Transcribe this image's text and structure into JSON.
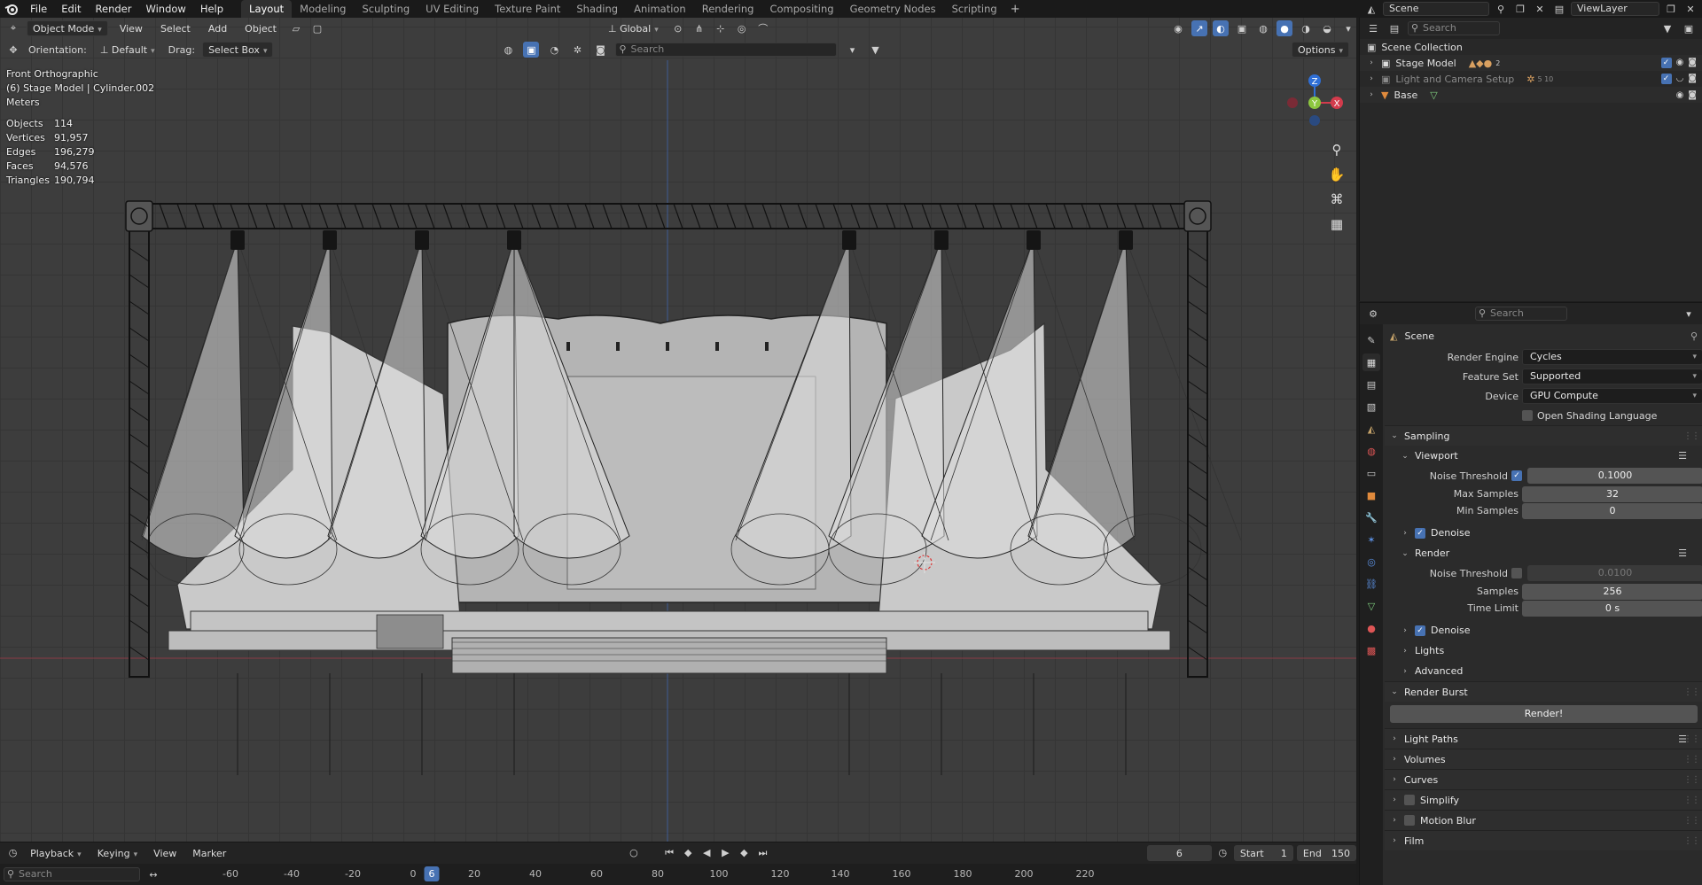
{
  "menu": {
    "items": [
      "File",
      "Edit",
      "Render",
      "Window",
      "Help"
    ]
  },
  "workspaces": [
    "Layout",
    "Modeling",
    "Sculpting",
    "UV Editing",
    "Texture Paint",
    "Shading",
    "Animation",
    "Rendering",
    "Compositing",
    "Geometry Nodes",
    "Scripting"
  ],
  "active_workspace": "Layout",
  "top_right": {
    "scene": "Scene",
    "view_layer": "ViewLayer"
  },
  "viewport": {
    "mode": "Object Mode",
    "menus": [
      "View",
      "Select",
      "Add",
      "Object"
    ],
    "transform_orientation": "Global",
    "orientation_label": "Orientation:",
    "orientation_value": "Default",
    "drag_label": "Drag:",
    "drag_value": "Select Box",
    "search_placeholder": "Search",
    "options": "Options",
    "overlay_lines": [
      "Front Orthographic",
      "(6) Stage Model | Cylinder.002",
      "Meters"
    ],
    "stats": [
      {
        "label": "Objects",
        "value": "114"
      },
      {
        "label": "Vertices",
        "value": "91,957"
      },
      {
        "label": "Edges",
        "value": "196,279"
      },
      {
        "label": "Faces",
        "value": "94,576"
      },
      {
        "label": "Triangles",
        "value": "190,794"
      }
    ],
    "gizmo": {
      "z": "Z",
      "y": "Y",
      "x": "X"
    }
  },
  "timeline": {
    "menus": [
      "Playback",
      "Keying",
      "View",
      "Marker"
    ],
    "current_frame": "6",
    "start_label": "Start",
    "start": "1",
    "end_label": "End",
    "end": "150",
    "search_placeholder": "Search",
    "ruler": [
      "-60",
      "-40",
      "-20",
      "0",
      "20",
      "40",
      "60",
      "80",
      "100",
      "120",
      "140",
      "160",
      "180",
      "200",
      "220"
    ],
    "ruler_current": "6"
  },
  "outliner": {
    "search_placeholder": "Search",
    "root": "Scene Collection",
    "items": [
      {
        "label": "Stage Model",
        "counts": "2"
      },
      {
        "label": "Light and Camera Setup",
        "counts": "5 10"
      },
      {
        "label": "Base",
        "counts": ""
      }
    ]
  },
  "properties": {
    "search_placeholder": "Search",
    "context": "Scene",
    "render_engine_label": "Render Engine",
    "render_engine": "Cycles",
    "feature_set_label": "Feature Set",
    "feature_set": "Supported",
    "device_label": "Device",
    "device": "GPU Compute",
    "osl_label": "Open Shading Language",
    "sampling": "Sampling",
    "viewport": "Viewport",
    "vp_noise_label": "Noise Threshold",
    "vp_noise": "0.1000",
    "vp_max_label": "Max Samples",
    "vp_max": "32",
    "vp_min_label": "Min Samples",
    "vp_min": "0",
    "denoise": "Denoise",
    "render": "Render",
    "r_noise_label": "Noise Threshold",
    "r_noise": "0.0100",
    "r_samples_label": "Samples",
    "r_samples": "256",
    "r_time_label": "Time Limit",
    "r_time": "0 s",
    "lights": "Lights",
    "advanced": "Advanced",
    "render_burst": "Render Burst",
    "render_button": "Render!",
    "light_paths": "Light Paths",
    "volumes": "Volumes",
    "curves": "Curves",
    "simplify": "Simplify",
    "motion_blur": "Motion Blur",
    "film": "Film"
  }
}
